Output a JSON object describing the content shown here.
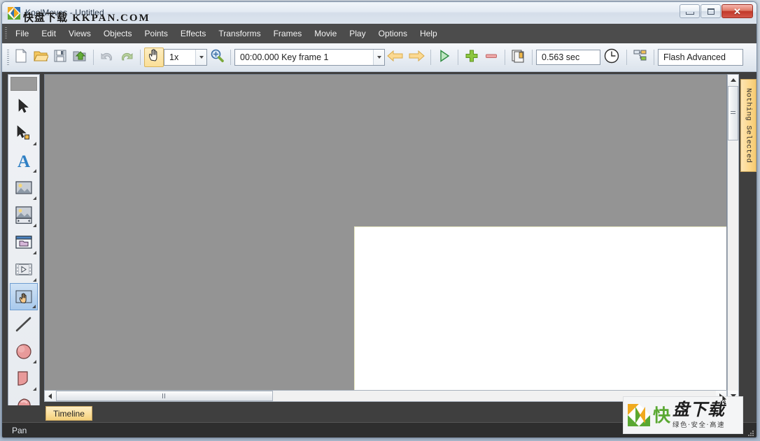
{
  "window": {
    "title": "KoolMoves - Untitled",
    "app_icon": "koolmoves-logo-icon",
    "controls": {
      "minimize": "minimize-icon",
      "maximize": "maximize-icon",
      "close": "close-icon",
      "close_glyph": "✕"
    }
  },
  "menubar": {
    "items": [
      {
        "label": "File"
      },
      {
        "label": "Edit"
      },
      {
        "label": "Views"
      },
      {
        "label": "Objects"
      },
      {
        "label": "Points"
      },
      {
        "label": "Effects"
      },
      {
        "label": "Transforms"
      },
      {
        "label": "Frames"
      },
      {
        "label": "Movie"
      },
      {
        "label": "Play"
      },
      {
        "label": "Options"
      },
      {
        "label": "Help"
      }
    ]
  },
  "toolbar": {
    "buttons": [
      {
        "name": "new-file-icon",
        "title": "New"
      },
      {
        "name": "open-file-icon",
        "title": "Open"
      },
      {
        "name": "save-file-icon",
        "title": "Save"
      },
      {
        "name": "export-icon",
        "title": "Export"
      },
      {
        "name": "undo-icon",
        "title": "Undo"
      },
      {
        "name": "redo-icon",
        "title": "Redo"
      },
      {
        "name": "pan-hand-icon",
        "title": "Pan"
      }
    ],
    "zoom_value": "1x",
    "zoom_in_icon": "magnifier-plus-icon",
    "keyframe_value": "00:00.000  Key frame 1",
    "prev_frame_icon": "arrow-left-icon",
    "next_frame_icon": "arrow-right-icon",
    "play_icon": "play-icon",
    "add_frame_icon": "plus-icon",
    "remove_frame_icon": "minus-icon",
    "frames_icon": "frames-stack-icon",
    "duration_value": "0.563 sec",
    "clock_icon": "clock-icon",
    "hierarchy_icon": "hierarchy-tree-icon",
    "export_format_value": "Flash Advanced"
  },
  "tools": {
    "items": [
      {
        "name": "select-arrow-tool",
        "label": "Select",
        "selected": false,
        "has_flyout": false
      },
      {
        "name": "point-select-tool",
        "label": "Point Select",
        "selected": false,
        "has_flyout": true
      },
      {
        "name": "text-tool",
        "label": "Text",
        "selected": false,
        "has_flyout": true
      },
      {
        "name": "image-tool",
        "label": "Image",
        "selected": false,
        "has_flyout": true
      },
      {
        "name": "image-sequence-tool",
        "label": "Image Sequence",
        "selected": false,
        "has_flyout": true
      },
      {
        "name": "window-folder-tool",
        "label": "Movie Clip",
        "selected": false,
        "has_flyout": true
      },
      {
        "name": "film-strip-tool",
        "label": "Film",
        "selected": false,
        "has_flyout": true
      },
      {
        "name": "pan-hand-tool",
        "label": "Pan",
        "selected": true,
        "has_flyout": true
      },
      {
        "name": "line-tool",
        "label": "Line",
        "selected": false,
        "has_flyout": false
      },
      {
        "name": "ellipse-tool",
        "label": "Ellipse",
        "selected": false,
        "has_flyout": true
      },
      {
        "name": "rectangle-tool",
        "label": "Rectangle",
        "selected": false,
        "has_flyout": true
      },
      {
        "name": "freeform-shape-tool",
        "label": "Freeform Shape",
        "selected": false,
        "has_flyout": true
      }
    ]
  },
  "panels": {
    "right_tab_label": "Nothing Selected",
    "timeline_tab_label": "Timeline"
  },
  "scrollbars": {
    "vertical": {
      "up_icon": "scroll-up-arrow-icon",
      "down_icon": "scroll-down-arrow-icon"
    },
    "horizontal": {
      "left_icon": "scroll-left-arrow-icon",
      "right_icon": "scroll-right-arrow-icon"
    }
  },
  "statusbar": {
    "message": "Pan"
  },
  "watermark": {
    "title_overlay_cn": "快盘下载",
    "title_overlay_latin": "KKPAN.COM",
    "badge_kuai": "快",
    "badge_main": "盘下载",
    "badge_sub": "绿色·安全·高速",
    "colors": {
      "green": "#5aa832",
      "orange": "#f0a91e",
      "dark": "#1e1e1e"
    }
  },
  "colors": {
    "menubar_bg": "#4c4c4c",
    "workspace_bg": "#3f3f3f",
    "canvas_bg": "#949494",
    "stage_bg": "#ffffff",
    "tab_accent": "#fbdf9b",
    "close_red": "#c1392a"
  }
}
